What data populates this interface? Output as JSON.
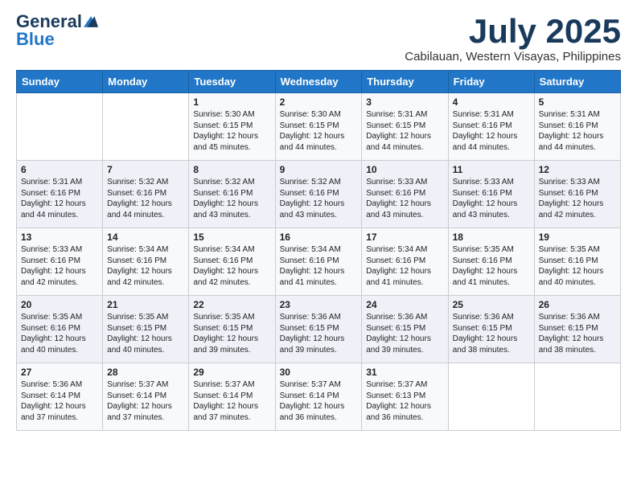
{
  "logo": {
    "general": "General",
    "blue": "Blue"
  },
  "header": {
    "month": "July 2025",
    "location": "Cabilauan, Western Visayas, Philippines"
  },
  "weekdays": [
    "Sunday",
    "Monday",
    "Tuesday",
    "Wednesday",
    "Thursday",
    "Friday",
    "Saturday"
  ],
  "weeks": [
    [
      {
        "day": "",
        "info": ""
      },
      {
        "day": "",
        "info": ""
      },
      {
        "day": "1",
        "info": "Sunrise: 5:30 AM\nSunset: 6:15 PM\nDaylight: 12 hours and 45 minutes."
      },
      {
        "day": "2",
        "info": "Sunrise: 5:30 AM\nSunset: 6:15 PM\nDaylight: 12 hours and 44 minutes."
      },
      {
        "day": "3",
        "info": "Sunrise: 5:31 AM\nSunset: 6:15 PM\nDaylight: 12 hours and 44 minutes."
      },
      {
        "day": "4",
        "info": "Sunrise: 5:31 AM\nSunset: 6:16 PM\nDaylight: 12 hours and 44 minutes."
      },
      {
        "day": "5",
        "info": "Sunrise: 5:31 AM\nSunset: 6:16 PM\nDaylight: 12 hours and 44 minutes."
      }
    ],
    [
      {
        "day": "6",
        "info": "Sunrise: 5:31 AM\nSunset: 6:16 PM\nDaylight: 12 hours and 44 minutes."
      },
      {
        "day": "7",
        "info": "Sunrise: 5:32 AM\nSunset: 6:16 PM\nDaylight: 12 hours and 44 minutes."
      },
      {
        "day": "8",
        "info": "Sunrise: 5:32 AM\nSunset: 6:16 PM\nDaylight: 12 hours and 43 minutes."
      },
      {
        "day": "9",
        "info": "Sunrise: 5:32 AM\nSunset: 6:16 PM\nDaylight: 12 hours and 43 minutes."
      },
      {
        "day": "10",
        "info": "Sunrise: 5:33 AM\nSunset: 6:16 PM\nDaylight: 12 hours and 43 minutes."
      },
      {
        "day": "11",
        "info": "Sunrise: 5:33 AM\nSunset: 6:16 PM\nDaylight: 12 hours and 43 minutes."
      },
      {
        "day": "12",
        "info": "Sunrise: 5:33 AM\nSunset: 6:16 PM\nDaylight: 12 hours and 42 minutes."
      }
    ],
    [
      {
        "day": "13",
        "info": "Sunrise: 5:33 AM\nSunset: 6:16 PM\nDaylight: 12 hours and 42 minutes."
      },
      {
        "day": "14",
        "info": "Sunrise: 5:34 AM\nSunset: 6:16 PM\nDaylight: 12 hours and 42 minutes."
      },
      {
        "day": "15",
        "info": "Sunrise: 5:34 AM\nSunset: 6:16 PM\nDaylight: 12 hours and 42 minutes."
      },
      {
        "day": "16",
        "info": "Sunrise: 5:34 AM\nSunset: 6:16 PM\nDaylight: 12 hours and 41 minutes."
      },
      {
        "day": "17",
        "info": "Sunrise: 5:34 AM\nSunset: 6:16 PM\nDaylight: 12 hours and 41 minutes."
      },
      {
        "day": "18",
        "info": "Sunrise: 5:35 AM\nSunset: 6:16 PM\nDaylight: 12 hours and 41 minutes."
      },
      {
        "day": "19",
        "info": "Sunrise: 5:35 AM\nSunset: 6:16 PM\nDaylight: 12 hours and 40 minutes."
      }
    ],
    [
      {
        "day": "20",
        "info": "Sunrise: 5:35 AM\nSunset: 6:16 PM\nDaylight: 12 hours and 40 minutes."
      },
      {
        "day": "21",
        "info": "Sunrise: 5:35 AM\nSunset: 6:15 PM\nDaylight: 12 hours and 40 minutes."
      },
      {
        "day": "22",
        "info": "Sunrise: 5:35 AM\nSunset: 6:15 PM\nDaylight: 12 hours and 39 minutes."
      },
      {
        "day": "23",
        "info": "Sunrise: 5:36 AM\nSunset: 6:15 PM\nDaylight: 12 hours and 39 minutes."
      },
      {
        "day": "24",
        "info": "Sunrise: 5:36 AM\nSunset: 6:15 PM\nDaylight: 12 hours and 39 minutes."
      },
      {
        "day": "25",
        "info": "Sunrise: 5:36 AM\nSunset: 6:15 PM\nDaylight: 12 hours and 38 minutes."
      },
      {
        "day": "26",
        "info": "Sunrise: 5:36 AM\nSunset: 6:15 PM\nDaylight: 12 hours and 38 minutes."
      }
    ],
    [
      {
        "day": "27",
        "info": "Sunrise: 5:36 AM\nSunset: 6:14 PM\nDaylight: 12 hours and 37 minutes."
      },
      {
        "day": "28",
        "info": "Sunrise: 5:37 AM\nSunset: 6:14 PM\nDaylight: 12 hours and 37 minutes."
      },
      {
        "day": "29",
        "info": "Sunrise: 5:37 AM\nSunset: 6:14 PM\nDaylight: 12 hours and 37 minutes."
      },
      {
        "day": "30",
        "info": "Sunrise: 5:37 AM\nSunset: 6:14 PM\nDaylight: 12 hours and 36 minutes."
      },
      {
        "day": "31",
        "info": "Sunrise: 5:37 AM\nSunset: 6:13 PM\nDaylight: 12 hours and 36 minutes."
      },
      {
        "day": "",
        "info": ""
      },
      {
        "day": "",
        "info": ""
      }
    ]
  ]
}
